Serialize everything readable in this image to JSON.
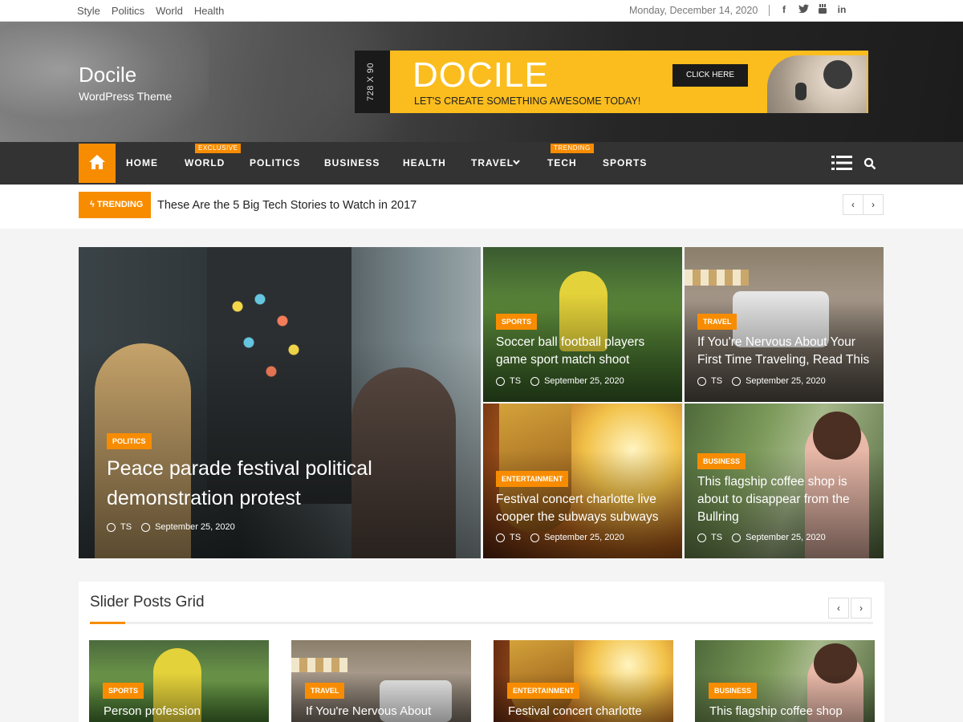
{
  "topbar": {
    "links": [
      "Style",
      "Politics",
      "World",
      "Health"
    ],
    "date": "Monday, December 14, 2020",
    "social": [
      "facebook-icon",
      "twitter-icon",
      "youtube-icon",
      "linkedin-icon"
    ]
  },
  "header": {
    "site_title": "Docile",
    "site_desc": "WordPress Theme",
    "ad": {
      "size_label": "728 X 90",
      "brand": "DOCILE",
      "tagline": "LET'S CREATE SOMETHING AWESOME TODAY!",
      "button": "CLICK HERE"
    }
  },
  "nav": {
    "items": [
      "HOME",
      "WORLD",
      "POLITICS",
      "BUSINESS",
      "HEALTH",
      "TRAVEL",
      "TECH",
      "SPORTS"
    ],
    "badges": {
      "world": "EXCLUSIVE",
      "tech": "TRENDING"
    }
  },
  "trending": {
    "label": "TRENDING",
    "text": "These Are the 5 Big Tech Stories to Watch in 2017",
    "prev": "‹",
    "next": "›"
  },
  "featured": {
    "main": {
      "category": "POLITICS",
      "title_l1": "Peace parade festival political",
      "title_l2": "demonstration protest",
      "author": "TS",
      "date": "September 25, 2020"
    },
    "cards": [
      {
        "category": "SPORTS",
        "title_l1": "Soccer ball football players",
        "title_l2": "game sport match shoot",
        "title_l3": "",
        "author": "TS",
        "date": "September 25, 2020"
      },
      {
        "category": "TRAVEL",
        "title_l1": "If You're Nervous About Your",
        "title_l2": "First Time Traveling, Read This",
        "title_l3": "",
        "author": "TS",
        "date": "September 25, 2020"
      },
      {
        "category": "ENTERTAINMENT",
        "title_l1": "Festival concert charlotte live",
        "title_l2": "cooper the subways subways",
        "title_l3": "",
        "author": "TS",
        "date": "September 25, 2020"
      },
      {
        "category": "BUSINESS",
        "title_l1": "This flagship coffee shop is",
        "title_l2": "about to disappear from the",
        "title_l3": "Bullring",
        "author": "TS",
        "date": "September 25, 2020"
      }
    ]
  },
  "slider": {
    "title": "Slider Posts Grid",
    "prev": "‹",
    "next": "›",
    "items": [
      {
        "category": "SPORTS",
        "title": "Person profession"
      },
      {
        "category": "TRAVEL",
        "title": "If You're Nervous About"
      },
      {
        "category": "ENTERTAINMENT",
        "title": "Festival concert charlotte"
      },
      {
        "category": "BUSINESS",
        "title": "This flagship coffee shop"
      }
    ]
  },
  "colors": {
    "accent": "#f88c00",
    "nav_bg": "#232323",
    "ad_yellow": "#fbbd1d"
  }
}
